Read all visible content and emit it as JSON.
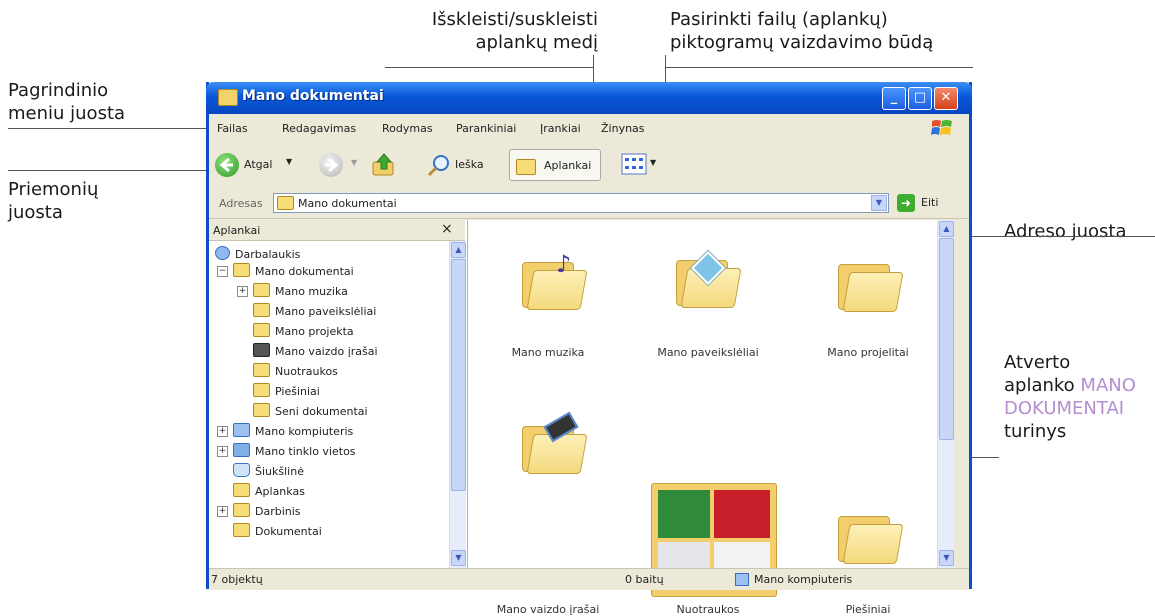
{
  "callouts": {
    "expand_tree": [
      "Išskleisti/suskleisti",
      "aplankų medį"
    ],
    "view_mode": [
      "Pasirinkti failų (aplankų)",
      "piktogramų vaizdavimo būdą"
    ],
    "menu_bar": [
      "Pagrindinio",
      "meniu juosta"
    ],
    "toolbar": [
      "Priemonių",
      "juosta"
    ],
    "address_bar": "Adreso juosta",
    "content": {
      "line1": "Atverto",
      "line2_a": "aplanko ",
      "line2_b": "MANO",
      "line3": "DOKUMENTAI",
      "line4": "turinys"
    }
  },
  "window": {
    "title": "Mano dokumentai",
    "minimize_glyph": "_",
    "maximize_glyph": "□",
    "close_glyph": "✕"
  },
  "menu": [
    "Failas",
    "Redagavimas",
    "Rodymas",
    "Parankiniai",
    "Įrankiai",
    "Žinynas"
  ],
  "toolbar": {
    "back": "Atgal",
    "search": "Ieška",
    "folders": "Aplankai"
  },
  "address": {
    "label": "Adresas",
    "value": "Mano dokumentai",
    "go": "Eiti"
  },
  "folder_pane": {
    "title": "Aplankai",
    "close": "×",
    "items": [
      "Darbalaukis",
      "Mano dokumentai",
      "Mano muzika",
      "Mano paveikslėliai",
      "Mano projekta",
      "Mano vaizdo įrašai",
      "Nuotraukos",
      "Piešiniai",
      "Seni dokumentai",
      "Mano kompiuteris",
      "Mano tinklo vietos",
      "Šiukšlinė",
      "Aplankas",
      "Darbinis",
      "Dokumentai"
    ]
  },
  "content_items": [
    "Mano muzika",
    "Mano paveikslėliai",
    "Mano projelitai",
    "Mano vaizdo įrašai",
    "Nuotraukos",
    "Piešiniai"
  ],
  "status": {
    "objects": "7 objektų",
    "size": "0 baitų",
    "location": "Mano kompiuteris"
  },
  "colors": {
    "titlebar": "#0857d8",
    "window_face": "#ece9d8",
    "callout_highlight": "#b48ed0"
  }
}
